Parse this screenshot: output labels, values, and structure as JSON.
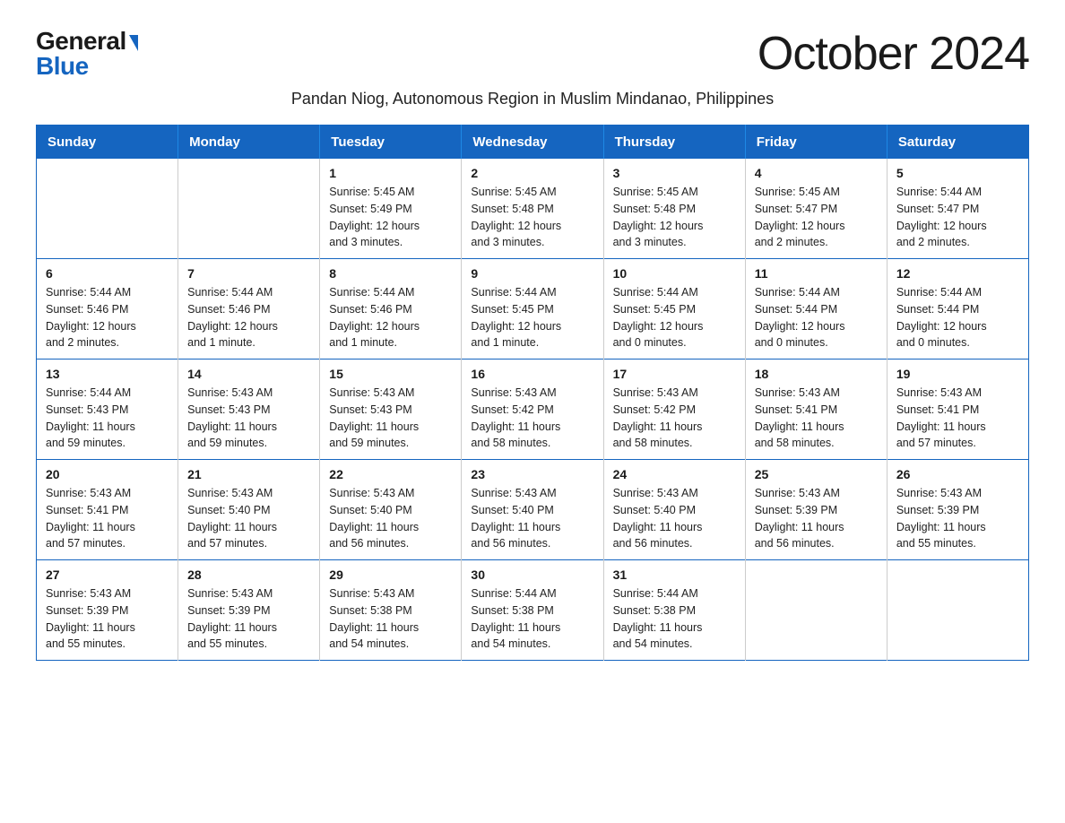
{
  "logo": {
    "general": "General",
    "blue": "Blue"
  },
  "title": "October 2024",
  "subtitle": "Pandan Niog, Autonomous Region in Muslim Mindanao, Philippines",
  "weekdays": [
    "Sunday",
    "Monday",
    "Tuesday",
    "Wednesday",
    "Thursday",
    "Friday",
    "Saturday"
  ],
  "weeks": [
    [
      {
        "day": "",
        "info": ""
      },
      {
        "day": "",
        "info": ""
      },
      {
        "day": "1",
        "info": "Sunrise: 5:45 AM\nSunset: 5:49 PM\nDaylight: 12 hours\nand 3 minutes."
      },
      {
        "day": "2",
        "info": "Sunrise: 5:45 AM\nSunset: 5:48 PM\nDaylight: 12 hours\nand 3 minutes."
      },
      {
        "day": "3",
        "info": "Sunrise: 5:45 AM\nSunset: 5:48 PM\nDaylight: 12 hours\nand 3 minutes."
      },
      {
        "day": "4",
        "info": "Sunrise: 5:45 AM\nSunset: 5:47 PM\nDaylight: 12 hours\nand 2 minutes."
      },
      {
        "day": "5",
        "info": "Sunrise: 5:44 AM\nSunset: 5:47 PM\nDaylight: 12 hours\nand 2 minutes."
      }
    ],
    [
      {
        "day": "6",
        "info": "Sunrise: 5:44 AM\nSunset: 5:46 PM\nDaylight: 12 hours\nand 2 minutes."
      },
      {
        "day": "7",
        "info": "Sunrise: 5:44 AM\nSunset: 5:46 PM\nDaylight: 12 hours\nand 1 minute."
      },
      {
        "day": "8",
        "info": "Sunrise: 5:44 AM\nSunset: 5:46 PM\nDaylight: 12 hours\nand 1 minute."
      },
      {
        "day": "9",
        "info": "Sunrise: 5:44 AM\nSunset: 5:45 PM\nDaylight: 12 hours\nand 1 minute."
      },
      {
        "day": "10",
        "info": "Sunrise: 5:44 AM\nSunset: 5:45 PM\nDaylight: 12 hours\nand 0 minutes."
      },
      {
        "day": "11",
        "info": "Sunrise: 5:44 AM\nSunset: 5:44 PM\nDaylight: 12 hours\nand 0 minutes."
      },
      {
        "day": "12",
        "info": "Sunrise: 5:44 AM\nSunset: 5:44 PM\nDaylight: 12 hours\nand 0 minutes."
      }
    ],
    [
      {
        "day": "13",
        "info": "Sunrise: 5:44 AM\nSunset: 5:43 PM\nDaylight: 11 hours\nand 59 minutes."
      },
      {
        "day": "14",
        "info": "Sunrise: 5:43 AM\nSunset: 5:43 PM\nDaylight: 11 hours\nand 59 minutes."
      },
      {
        "day": "15",
        "info": "Sunrise: 5:43 AM\nSunset: 5:43 PM\nDaylight: 11 hours\nand 59 minutes."
      },
      {
        "day": "16",
        "info": "Sunrise: 5:43 AM\nSunset: 5:42 PM\nDaylight: 11 hours\nand 58 minutes."
      },
      {
        "day": "17",
        "info": "Sunrise: 5:43 AM\nSunset: 5:42 PM\nDaylight: 11 hours\nand 58 minutes."
      },
      {
        "day": "18",
        "info": "Sunrise: 5:43 AM\nSunset: 5:41 PM\nDaylight: 11 hours\nand 58 minutes."
      },
      {
        "day": "19",
        "info": "Sunrise: 5:43 AM\nSunset: 5:41 PM\nDaylight: 11 hours\nand 57 minutes."
      }
    ],
    [
      {
        "day": "20",
        "info": "Sunrise: 5:43 AM\nSunset: 5:41 PM\nDaylight: 11 hours\nand 57 minutes."
      },
      {
        "day": "21",
        "info": "Sunrise: 5:43 AM\nSunset: 5:40 PM\nDaylight: 11 hours\nand 57 minutes."
      },
      {
        "day": "22",
        "info": "Sunrise: 5:43 AM\nSunset: 5:40 PM\nDaylight: 11 hours\nand 56 minutes."
      },
      {
        "day": "23",
        "info": "Sunrise: 5:43 AM\nSunset: 5:40 PM\nDaylight: 11 hours\nand 56 minutes."
      },
      {
        "day": "24",
        "info": "Sunrise: 5:43 AM\nSunset: 5:40 PM\nDaylight: 11 hours\nand 56 minutes."
      },
      {
        "day": "25",
        "info": "Sunrise: 5:43 AM\nSunset: 5:39 PM\nDaylight: 11 hours\nand 56 minutes."
      },
      {
        "day": "26",
        "info": "Sunrise: 5:43 AM\nSunset: 5:39 PM\nDaylight: 11 hours\nand 55 minutes."
      }
    ],
    [
      {
        "day": "27",
        "info": "Sunrise: 5:43 AM\nSunset: 5:39 PM\nDaylight: 11 hours\nand 55 minutes."
      },
      {
        "day": "28",
        "info": "Sunrise: 5:43 AM\nSunset: 5:39 PM\nDaylight: 11 hours\nand 55 minutes."
      },
      {
        "day": "29",
        "info": "Sunrise: 5:43 AM\nSunset: 5:38 PM\nDaylight: 11 hours\nand 54 minutes."
      },
      {
        "day": "30",
        "info": "Sunrise: 5:44 AM\nSunset: 5:38 PM\nDaylight: 11 hours\nand 54 minutes."
      },
      {
        "day": "31",
        "info": "Sunrise: 5:44 AM\nSunset: 5:38 PM\nDaylight: 11 hours\nand 54 minutes."
      },
      {
        "day": "",
        "info": ""
      },
      {
        "day": "",
        "info": ""
      }
    ]
  ]
}
